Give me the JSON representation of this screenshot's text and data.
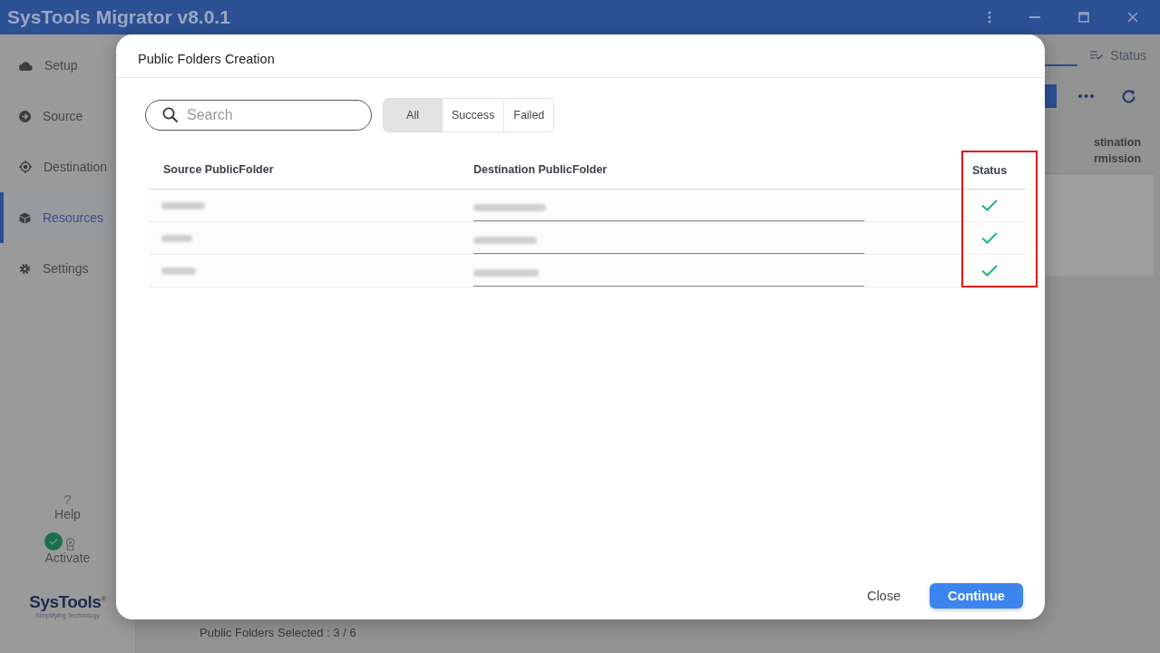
{
  "window": {
    "title": "SysTools Migrator v8.0.1"
  },
  "sidebar": {
    "items": [
      {
        "label": "Setup",
        "kind": "cloud",
        "selected": false
      },
      {
        "label": "Source",
        "kind": "arrow",
        "selected": false
      },
      {
        "label": "Destination",
        "kind": "target",
        "selected": false
      },
      {
        "label": "Resources",
        "kind": "cube",
        "selected": true
      },
      {
        "label": "Settings",
        "kind": "gear",
        "selected": false
      }
    ],
    "help_icon": "?",
    "help": "Help",
    "activate": {
      "label": "Activate",
      "activated": true
    },
    "logo": {
      "name": "SysTools",
      "mark": "®",
      "tagline": "Simplifying Technology"
    }
  },
  "background": {
    "tabs": [
      {
        "label": "Status",
        "selected": false
      }
    ],
    "column_heading": [
      "stination",
      "rmission"
    ],
    "status_bar": "Public Folders Selected : 3 / 6"
  },
  "dialog": {
    "title": "Public Folders Creation",
    "search": {
      "placeholder": "Search"
    },
    "filters": [
      {
        "label": "All",
        "selected": true
      },
      {
        "label": "Success",
        "selected": false
      },
      {
        "label": "Failed",
        "selected": false
      }
    ],
    "columns": [
      "Source PublicFolder",
      "Destination PublicFolder",
      "Status"
    ],
    "rows": [
      {
        "success": true
      },
      {
        "success": true
      },
      {
        "success": true
      }
    ],
    "buttons": [
      {
        "label": "Close",
        "kind": "text"
      },
      {
        "label": "Continue",
        "kind": "primary"
      }
    ]
  }
}
